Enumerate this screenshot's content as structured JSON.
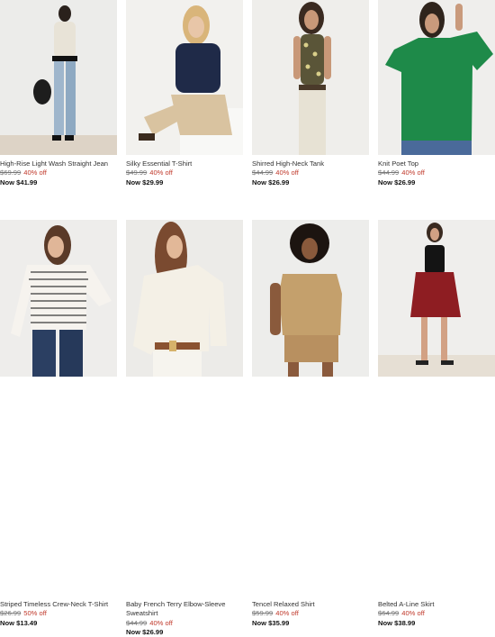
{
  "products": [
    {
      "name": "High-Rise Light Wash Straight Jean",
      "original_price": "$69.99",
      "discount": "40% off",
      "now_price": "Now $41.99",
      "image": "woman-white-jacket-jeans"
    },
    {
      "name": "Silky Essential T-Shirt",
      "original_price": "$49.99",
      "discount": "40% off",
      "now_price": "Now $29.99",
      "image": "woman-navy-tshirt-khakis"
    },
    {
      "name": "Shirred High-Neck Tank",
      "original_price": "$44.99",
      "discount": "40% off",
      "now_price": "Now $26.99",
      "image": "woman-leopard-tank-white-pants"
    },
    {
      "name": "Knit Poet Top",
      "original_price": "$44.99",
      "discount": "40% off",
      "now_price": "Now $26.99",
      "image": "woman-green-poet-top"
    },
    {
      "name": "Striped Timeless Crew-Neck T-Shirt",
      "original_price": "$26.99",
      "discount": "50% off",
      "now_price": "Now $13.49",
      "image": "woman-striped-shirt-jeans"
    },
    {
      "name": "Baby French Terry Elbow-Sleeve",
      "name_line2": "Sweatshirt",
      "original_price": "$44.99",
      "discount": "40% off",
      "now_price": "Now $26.99",
      "image": "woman-cream-sweatshirt"
    },
    {
      "name": "Tencel Relaxed Shirt",
      "original_price": "$59.99",
      "discount": "40% off",
      "now_price": "Now $35.99",
      "image": "woman-tan-shirt-shorts"
    },
    {
      "name": "Belted A-Line Skirt",
      "original_price": "$64.99",
      "discount": "40% off",
      "now_price": "Now $38.99",
      "image": "woman-black-tank-red-skirt"
    }
  ],
  "colors": {
    "discount": "#c0392b",
    "text": "#222222",
    "muted": "#777777"
  }
}
